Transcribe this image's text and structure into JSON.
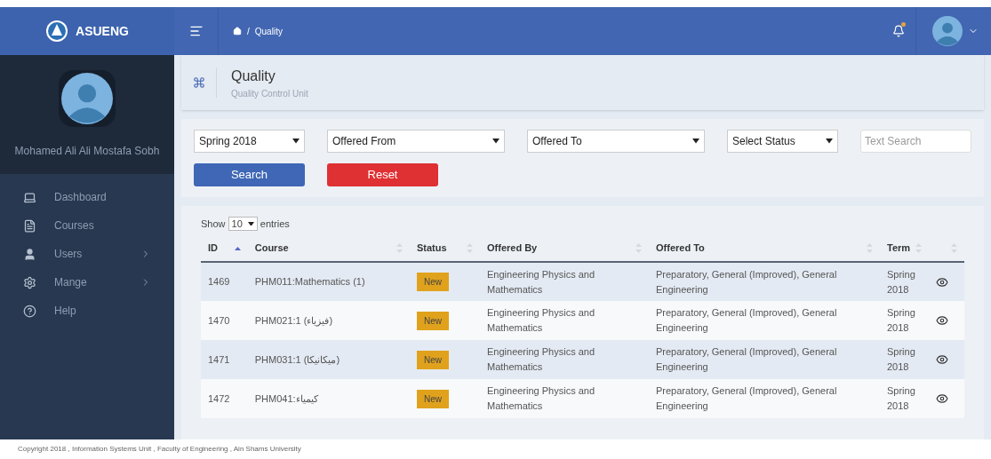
{
  "brand": {
    "name": "ASUENG"
  },
  "breadcrumb": {
    "separator": "/",
    "items": [
      "Quality"
    ]
  },
  "notifications": {
    "unread": true
  },
  "user": {
    "name": "Mohamed Ali Ali Mostafa Sobh"
  },
  "sidebar": {
    "items": [
      {
        "label": "Dashboard",
        "has_submenu": false
      },
      {
        "label": "Courses",
        "has_submenu": false
      },
      {
        "label": "Users",
        "has_submenu": true
      },
      {
        "label": "Mange",
        "has_submenu": true
      },
      {
        "label": "Help",
        "has_submenu": false
      }
    ]
  },
  "page_header": {
    "title": "Quality",
    "subtitle": "Quality Control Unit"
  },
  "filters": {
    "selects": [
      {
        "value": "Spring 2018"
      },
      {
        "value": "Offered From"
      },
      {
        "value": "Offered To"
      },
      {
        "value": "Select Status"
      }
    ],
    "text_search": {
      "placeholder": "Text Search"
    },
    "buttons": [
      {
        "label": "Search",
        "kind": "primary"
      },
      {
        "label": "Reset",
        "kind": "danger"
      }
    ]
  },
  "table": {
    "show_prefix": "Show",
    "page_size": "10",
    "show_suffix": "entries",
    "columns": [
      {
        "label": "ID",
        "sorted": true
      },
      {
        "label": "Course",
        "sorted": false
      },
      {
        "label": "Status",
        "sorted": false
      },
      {
        "label": "Offered By",
        "sorted": false
      },
      {
        "label": "Offered To",
        "sorted": false
      },
      {
        "label": "Term",
        "sorted": false
      }
    ],
    "rows": [
      {
        "id": "1469",
        "course": "PHM011:Mathematics (1)",
        "status": "New",
        "offered_by": "Engineering Physics and Mathematics",
        "offered_to": "Preparatory, General (Improved), General Engineering",
        "term": "Spring 2018"
      },
      {
        "id": "1470",
        "course": "PHM021:1 (فيزياء)",
        "status": "New",
        "offered_by": "Engineering Physics and Mathematics",
        "offered_to": "Preparatory, General (Improved), General Engineering",
        "term": "Spring 2018"
      },
      {
        "id": "1471",
        "course": "PHM031:1 (ميكانيكا)",
        "status": "New",
        "offered_by": "Engineering Physics and Mathematics",
        "offered_to": "Preparatory, General (Improved), General Engineering",
        "term": "Spring 2018"
      },
      {
        "id": "1472",
        "course": "PHM041:كيمياء",
        "status": "New",
        "offered_by": "Engineering Physics and Mathematics",
        "offered_to": "Preparatory, General (Improved), General Engineering",
        "term": "Spring 2018"
      }
    ]
  },
  "footer": {
    "copyright": "Copyright 2018 , Information Systems Unit , Faculty of Engineering , Ain Shams University"
  }
}
